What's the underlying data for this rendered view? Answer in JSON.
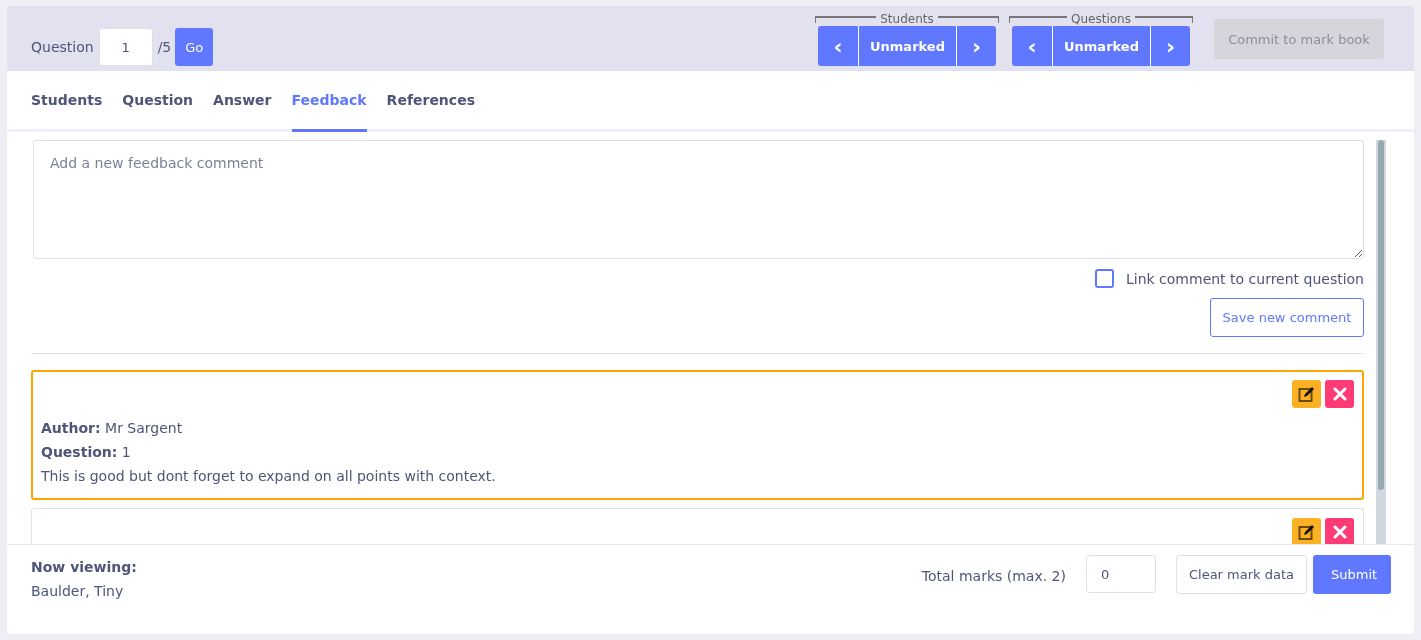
{
  "question_nav": {
    "label": "Question",
    "value": "1",
    "total": "/5",
    "go": "Go"
  },
  "groups": [
    {
      "title": "Students",
      "left": "‹",
      "middle": "Unmarked",
      "right": "›"
    },
    {
      "title": "Questions",
      "left": "‹",
      "middle": "Unmarked",
      "right": "›"
    }
  ],
  "commit": {
    "label": "Commit to mark book",
    "disabled": true
  },
  "tabs": [
    {
      "label": "Students",
      "selected": false
    },
    {
      "label": "Question",
      "selected": false
    },
    {
      "label": "Answer",
      "selected": false
    },
    {
      "label": "Feedback",
      "selected": true
    },
    {
      "label": "References",
      "selected": false
    }
  ],
  "new_comment": {
    "placeholder": "Add a new feedback comment",
    "link_label": "Link comment to current question",
    "link_checked": false,
    "save": "Save new comment"
  },
  "comments": [
    {
      "selected": true,
      "author_label": "Author:",
      "author": "Mr Sargent",
      "question_label": "Question:",
      "question": "1",
      "text": "This is good but dont forget to expand on all points with context."
    },
    {
      "selected": false
    }
  ],
  "footer": {
    "viewing_label": "Now viewing:",
    "viewing": "Baulder, Tiny",
    "total_label": "Total marks (max. 2)",
    "total_value": "0",
    "clear": "Clear mark data",
    "submit": "Submit"
  }
}
